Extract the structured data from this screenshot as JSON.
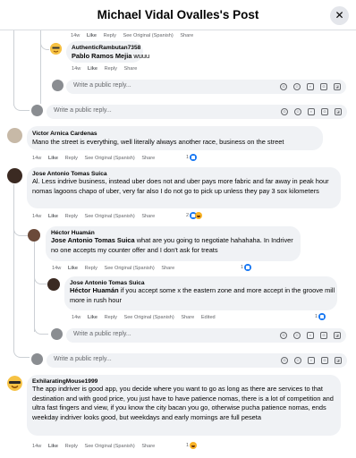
{
  "header": {
    "title": "Michael Vidal Ovalles's Post",
    "close_glyph": "✕"
  },
  "reply_placeholder": "Write a public reply...",
  "action_labels": {
    "like": "Like",
    "reply": "Reply",
    "see_original": "See Original (Spanish)",
    "share": "Share",
    "edited": "Edited"
  },
  "reply_box_icons": [
    "gif-icon",
    "emoji-icon",
    "camera-icon",
    "gif-sticker-icon",
    "sticker-icon"
  ],
  "comments": [
    {
      "id": "top-actions",
      "time": "14w"
    },
    {
      "id": "authentic",
      "author": "AuthenticRambutan7358",
      "mention": "Pablo Ramos Mejia",
      "text": "wuuu",
      "time": "14w"
    },
    {
      "id": "victor",
      "author": "Victor Arnica Cardenas",
      "text": "Mano the street is everything, well literally always another race, business on the street",
      "time": "14w",
      "reactions": "1"
    },
    {
      "id": "jose1",
      "author": "Jose Antonio Tomas Suica",
      "text": "Al. Less indrive business, instead uber does not and uber pays more fabric and far away in peak hour nomas lagoons chapo of uber, very far also I do not go to pick up unless they pay 3 sox kilometers",
      "time": "14w",
      "reactions": "2"
    },
    {
      "id": "hector",
      "author": "Héctor Huamán",
      "mention": "Jose Antonio Tomas Suica",
      "text": "what are you going to negotiate hahahaha. In Indriver no one accepts my counter offer and I don't ask for treats",
      "time": "14w",
      "reactions": "1"
    },
    {
      "id": "jose2",
      "author": "Jose Antonio Tomas Suica",
      "mention": "Héctor Huamán",
      "text": "if you accept some x the eastern zone and more accept in the groove mill more in rush hour",
      "time": "14w",
      "reactions": "1"
    },
    {
      "id": "exhilarating",
      "author": "ExhilaratingMouse1999",
      "text": "The app indriver is good app, you decide where you want to go as long as there are services to that destination and with good price, you just have to have patience nomas, there is a lot of competition and ultra fast fingers and view, if you know the city bacan you go, otherwise pucha patience nomas, ends weekday indriver looks good, but weekdays and early mornings are full peseta",
      "time": "14w",
      "reactions": "1"
    }
  ]
}
